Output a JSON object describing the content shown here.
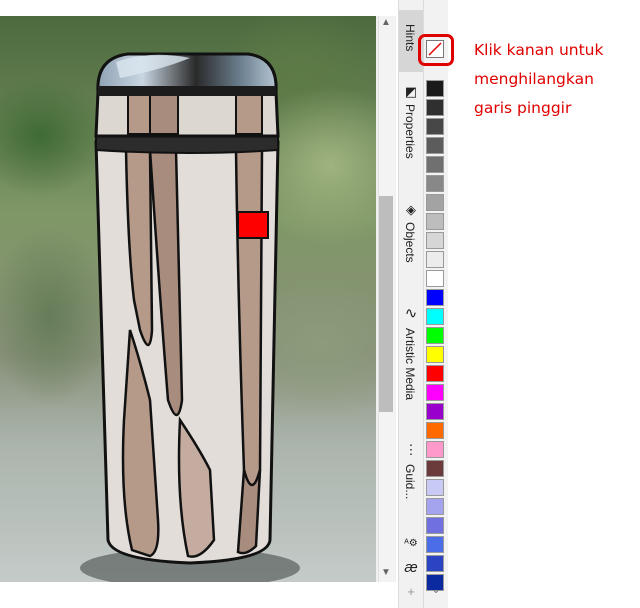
{
  "annotation": {
    "line1": "Klik kanan untuk",
    "line2": "menghilangkan",
    "line3": "garis pinggir"
  },
  "docker_tabs": [
    {
      "label": "Hints",
      "icon": "hints-icon"
    },
    {
      "label": "Properties",
      "icon": "properties-icon"
    },
    {
      "label": "Objects",
      "icon": "layers-icon"
    },
    {
      "label": "Artistic Media",
      "icon": "artistic-media-icon"
    },
    {
      "label": "Guid...",
      "icon": "guidelines-icon"
    }
  ],
  "palette_colors": [
    "#1a1a1a",
    "#2f2f2f",
    "#474747",
    "#5c5c5c",
    "#707070",
    "#888888",
    "#a3a3a3",
    "#bdbdbd",
    "#d6d6d6",
    "#ececec",
    "#ffffff",
    "#0000ff",
    "#00ffff",
    "#00ff00",
    "#ffff00",
    "#ff0000",
    "#ff00ff",
    "#9900cc",
    "#ff6a00",
    "#ff99cc",
    "#6b3a3a",
    "#c9c9f5",
    "#a3a3ee",
    "#7070e0",
    "#4b6ee8",
    "#2b44c4",
    "#0b2aa0"
  ],
  "colors": {
    "annotation": "#e00000",
    "highlight": "#e00000",
    "thermos_body": "#e2ddd8",
    "thermos_stripes": "#b59a8a",
    "thermos_label": "#ff0000",
    "cap": "#2c2c2c"
  }
}
